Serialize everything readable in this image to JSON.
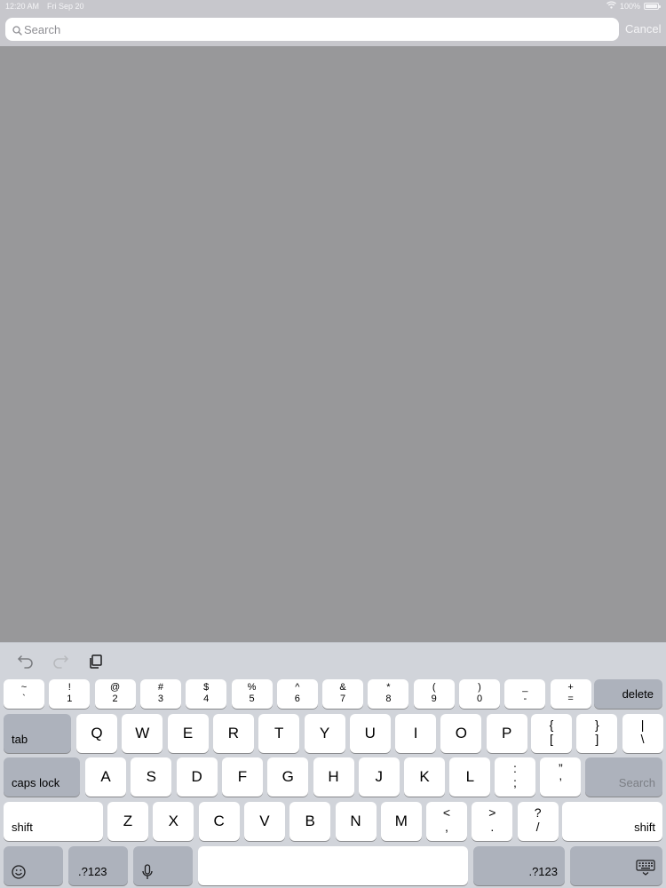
{
  "status_bar": {
    "time": "12:20 AM",
    "date": "Fri Sep 20",
    "battery_text": "100%",
    "battery_level": 1.0
  },
  "search": {
    "placeholder": "Search",
    "value": "",
    "cancel_label": "Cancel"
  },
  "shortcut_bar": {
    "items": [
      {
        "icon": "undo-icon"
      },
      {
        "icon": "redo-icon"
      },
      {
        "icon": "paste-icon"
      }
    ]
  },
  "keyboard": {
    "row1": [
      {
        "top": "~",
        "bot": "`"
      },
      {
        "top": "!",
        "bot": "1"
      },
      {
        "top": "@",
        "bot": "2"
      },
      {
        "top": "#",
        "bot": "3"
      },
      {
        "top": "$",
        "bot": "4"
      },
      {
        "top": "%",
        "bot": "5"
      },
      {
        "top": "^",
        "bot": "6"
      },
      {
        "top": "&",
        "bot": "7"
      },
      {
        "top": "*",
        "bot": "8"
      },
      {
        "top": "(",
        "bot": "9"
      },
      {
        "top": ")",
        "bot": "0"
      },
      {
        "top": "_",
        "bot": "-"
      },
      {
        "top": "+",
        "bot": "="
      }
    ],
    "delete_label": "delete",
    "tab_label": "tab",
    "row2_letters": [
      "Q",
      "W",
      "E",
      "R",
      "T",
      "Y",
      "U",
      "I",
      "O",
      "P"
    ],
    "row2_symbols": [
      {
        "top": "{",
        "bot": "["
      },
      {
        "top": "}",
        "bot": "]"
      },
      {
        "top": "|",
        "bot": "\\"
      }
    ],
    "caps_lock_label": "caps lock",
    "row3_letters": [
      "A",
      "S",
      "D",
      "F",
      "G",
      "H",
      "J",
      "K",
      "L"
    ],
    "row3_symbols": [
      {
        "top": ":",
        "bot": ";"
      },
      {
        "top": "”",
        "bot": "’"
      }
    ],
    "search_key_label": "Search",
    "shift_left_label": "shift",
    "row4_letters": [
      "Z",
      "X",
      "C",
      "V",
      "B",
      "N",
      "M"
    ],
    "row4_symbols": [
      {
        "top": "<",
        "bot": ","
      },
      {
        "top": ">",
        "bot": "."
      },
      {
        "top": "?",
        "bot": "/"
      }
    ],
    "shift_right_label": "shift",
    "numbers_left_label": ".?123",
    "numbers_right_label": ".?123",
    "emoji_icon": "emoji-icon",
    "dictation_icon": "microphone-icon",
    "dismiss_icon": "keyboard-dismiss-icon"
  }
}
